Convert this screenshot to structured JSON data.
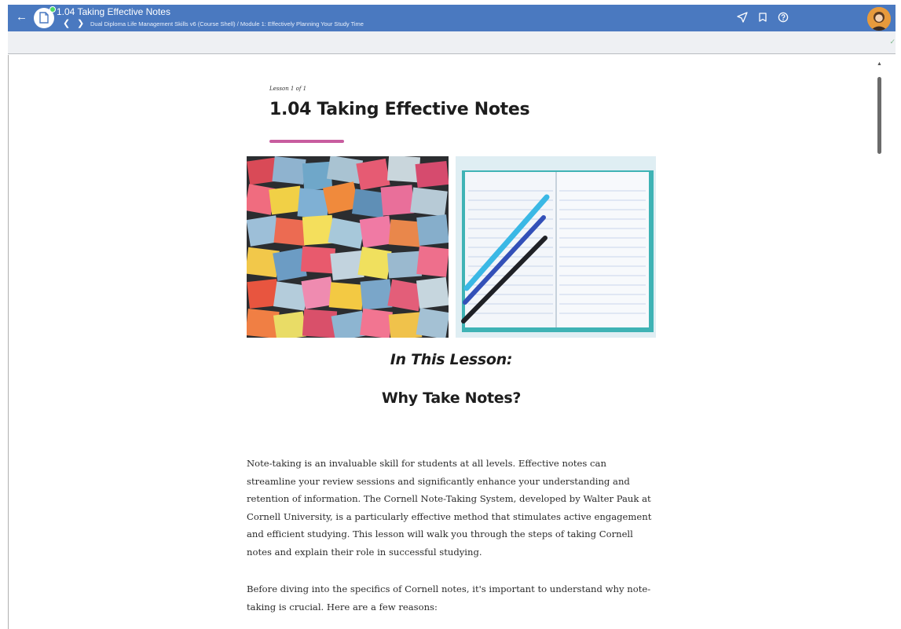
{
  "header": {
    "topic_title": "1.04 Taking Effective Notes",
    "breadcrumb": "Dual Diploma Life Management Skills v6 (Course Shell) / Module 1: Effectively Planning Your Study Time",
    "icons": {
      "back": "arrow-left-icon",
      "topic_type": "document-icon",
      "status": "status-dot-icon",
      "prev": "chevron-left-icon",
      "next": "chevron-right-icon",
      "send": "paper-plane-icon",
      "notes": "bookmark-icon",
      "help": "help-circle-icon",
      "complete": "check-icon"
    },
    "colors": {
      "bar": "#4a79c0",
      "status": "#4cd964",
      "accent": "#c85d9f"
    }
  },
  "lesson": {
    "counter": "Lesson 1 of 1",
    "title": "1.04 Taking Effective Notes",
    "heading_in_this_lesson": "In This Lesson:",
    "heading_why": "Why Take Notes?",
    "paragraph_1": "Note-taking is an invaluable skill for students at all levels. Effective notes can streamline your review sessions and significantly enhance your understanding and retention of information. The Cornell Note-Taking System, developed by Walter Pauk at Cornell University, is a particularly effective method that stimulates active engagement and efficient studying. This lesson will walk you through the steps of taking Cornell notes and explain their role in successful studying.",
    "paragraph_2": "Before diving into the specifics of Cornell notes, it's important to understand why note-taking is crucial. Here are a few reasons:"
  }
}
